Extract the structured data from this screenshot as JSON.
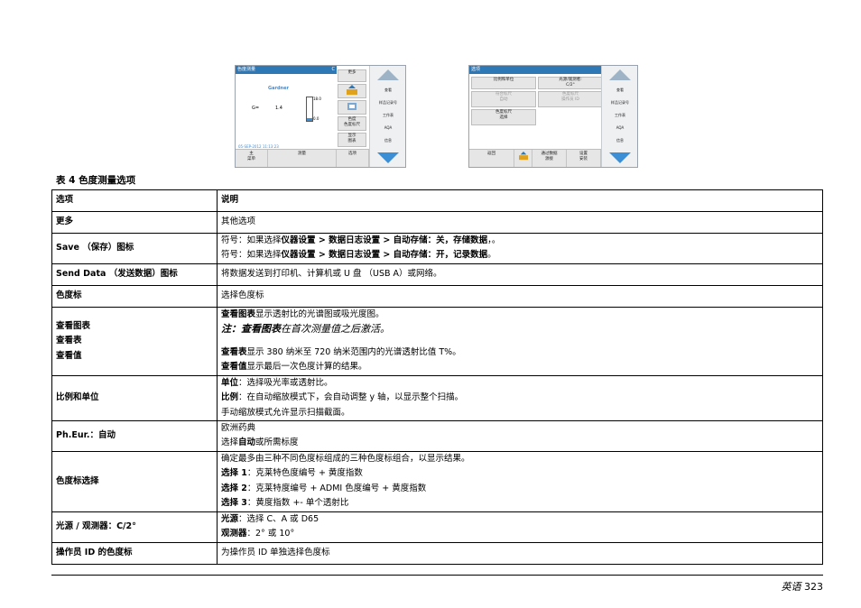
{
  "screen1": {
    "title": "色度测量",
    "title_right": "C",
    "method": "Gardner",
    "reading_label": "G=",
    "reading_value": "1.4",
    "bar_max": "18.0",
    "bar_min": "0.0",
    "timestamp": "05-SEP-2012  11:13:23",
    "menu": [
      "更多",
      "色度\n色度标尺",
      "显示\n图表"
    ],
    "side": [
      "查看",
      "样品记录号",
      "工作表",
      "AQA",
      "信息"
    ],
    "bottom": [
      "主\n菜单",
      "测量",
      "选项"
    ]
  },
  "screen2": {
    "title": "选项",
    "buttons": [
      "比例和单位",
      "光源/观测者:\nC/2°",
      "符合标尺\n自动",
      "色度标尺选择",
      "色度标尺\n选择",
      "色度标尺\n操作员 ID"
    ],
    "side": [
      "查看",
      "样品记录号",
      "工作表",
      "AQA",
      "信息"
    ],
    "bottom": [
      "返回",
      "",
      "通过数据\n源接",
      "设置\n安装"
    ]
  },
  "caption": "表 4  色度测量选项",
  "table": {
    "headers": [
      "选项",
      "说明"
    ],
    "rows": [
      {
        "option": "更多",
        "desc": "其他选项"
      },
      {
        "option": "Save （保存）图标"
      },
      {
        "option": "Send Data （发送数据）图标",
        "desc": "将数据发送到打印机、计算机或 U 盘 （USB A）或网络。"
      },
      {
        "option": "色度标",
        "desc": "选择色度标"
      },
      {
        "option_lines": [
          "查看图表",
          "查看表",
          "查看值"
        ]
      },
      {
        "option": "比例和单位"
      },
      {
        "option": "Ph.Eur.：自动"
      },
      {
        "option": "色度标选择"
      },
      {
        "option": "光源 / 观测器：C/2°"
      },
      {
        "option": "操作员 ID 的色度标",
        "desc": "为操作员 ID 单独选择色度标"
      }
    ],
    "save": {
      "l1_pre": "符号：如果选择",
      "l1_b": "仪器设置 > 数据日志设置 > 自动存储：关，存储数据",
      "l1_post": "，。",
      "l2_pre": "符号：如果选择",
      "l2_b": "仪器设置 > 数据日志设置 > 自动存储：开，记录数据",
      "l2_post": "。"
    },
    "view": {
      "l1_b": "查看图表",
      "l1": "显示透射比的光谱图或吸光度图。",
      "note_b": "注：查看图表",
      "note": "在首次测量值之后激活。",
      "l3_b": "查看表",
      "l3": "显示 380 纳米至 720 纳米范围内的光谱透射比值 T%。",
      "l4_b": "查看值",
      "l4": "显示最后一次色度计算的结果。"
    },
    "scale": {
      "l1_b": "单位",
      "l1": "：选择吸光率或透射比。",
      "l2_b": "比例",
      "l2": "：在自动缩放模式下，会自动调整 y 轴，以显示整个扫描。",
      "l3": "手动缩放模式允许显示扫描截面。"
    },
    "pheur": {
      "l1": "欧洲药典",
      "l2_pre": "选择",
      "l2_b": "自动",
      "l2_post": "或所需标度"
    },
    "colorsel": {
      "l1": "确定最多由三种不同色度标组成的三种色度标组合，以显示结果。",
      "l2_b": "选择 1",
      "l2": "：克莱特色度编号 + 黄度指数",
      "l3_b": "选择 2",
      "l3": "：克莱特度编号 + ADMI 色度编号 + 黄度指数",
      "l4_b": "选择 3",
      "l4": "：黄度指数 +- 单个透射比"
    },
    "illum": {
      "l1_b": "光源",
      "l1": "：选择 C、A 或 D65",
      "l2_b": "观测器",
      "l2": "：2° 或 10°"
    }
  },
  "footer": {
    "lang": "英语",
    "page": "323"
  }
}
